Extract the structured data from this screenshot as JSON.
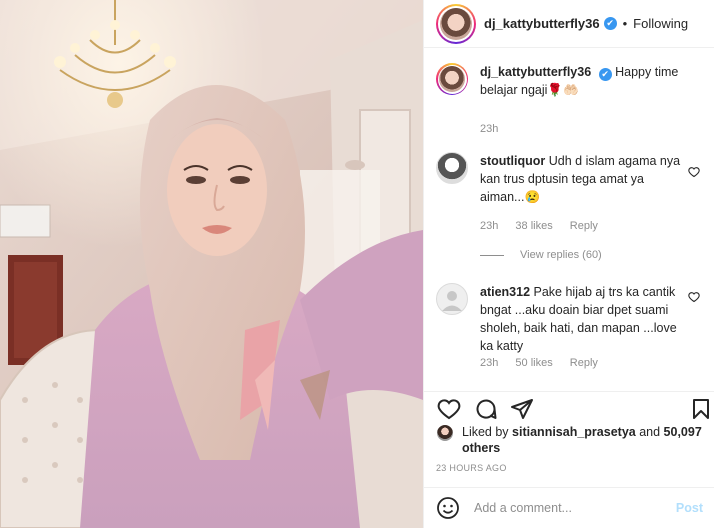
{
  "post": {
    "author": "dj_kattybutterfly36",
    "follow_status": "Following",
    "separator": "•",
    "verified_glyph": "✔"
  },
  "caption": {
    "username": "dj_kattybutterfly36",
    "text": "Happy time belajar ngaji🌹🤲🏻",
    "time": "23h"
  },
  "comments": [
    {
      "username": "stoutliquor",
      "text": "Udh d islam agama nya kan trus dptusin tega amat ya aiman...😢",
      "time": "23h",
      "likes": "38 likes",
      "reply_label": "Reply",
      "view_replies": "View replies (60)"
    },
    {
      "username": "atien312",
      "text": "Pake hijab aj trs ka cantik bngat ...aku doain biar dpet suami sholeh, baik hati, dan mapan ...love ka katty",
      "time": "23h",
      "likes": "50 likes",
      "reply_label": "Reply"
    }
  ],
  "likes": {
    "prefix": "Liked by",
    "user": "sitiannisah_prasetya",
    "and_text": "and",
    "others": "50,097 others"
  },
  "posted_ago": "23 HOURS AGO",
  "composer": {
    "placeholder": "Add a comment...",
    "post_label": "Post"
  },
  "icons": {
    "like": "heart-icon",
    "comment": "comment-icon",
    "share": "share-icon",
    "save": "bookmark-icon",
    "emoji": "emoji-icon"
  },
  "colors": {
    "verified": "#3897f0",
    "post_disabled": "#b2dffc",
    "muted_text": "#8e8e8e"
  }
}
